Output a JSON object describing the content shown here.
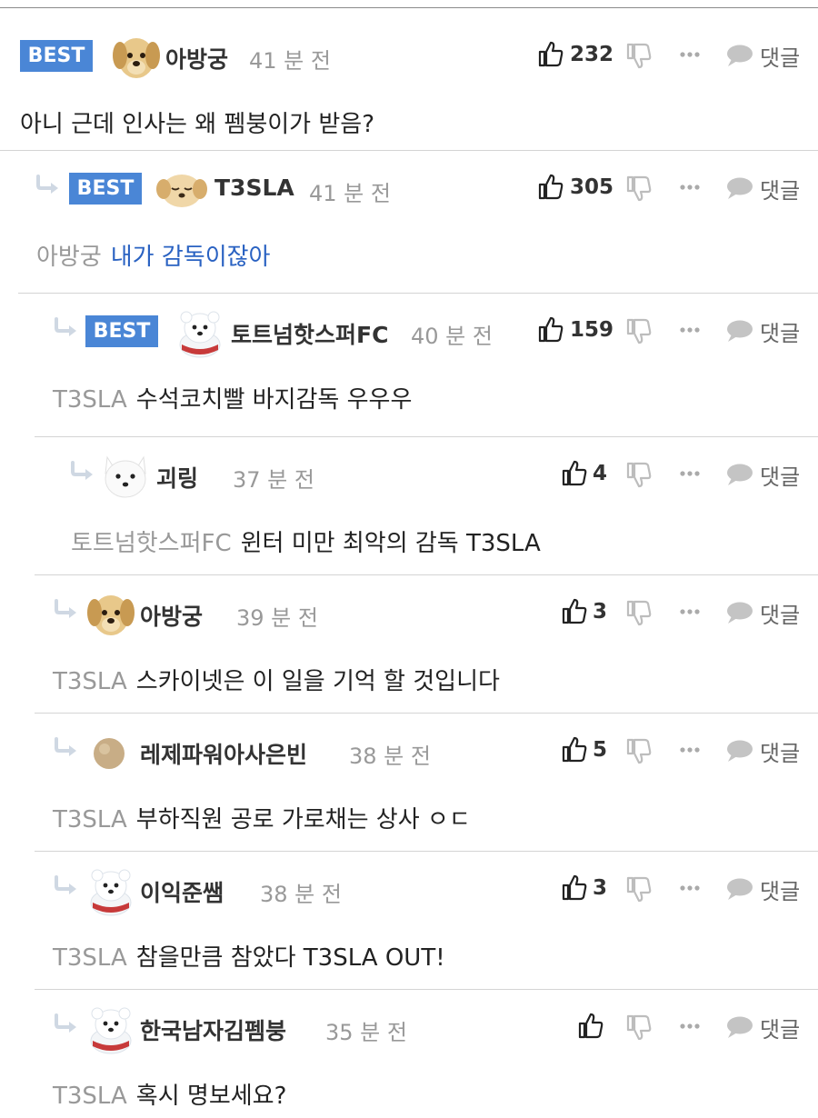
{
  "comments": [
    {
      "best": true,
      "avatar": "puppy",
      "author": "아방궁",
      "time": "41 분 전",
      "likes": "232",
      "mention": "",
      "text": "아니 근데 인사는 왜 펨붕이가 받음?"
    },
    {
      "best": true,
      "avatar": "puppy-sleepy",
      "author": "T3SLA",
      "time": "41 분 전",
      "likes": "305",
      "mention": "아방궁",
      "text": "내가 감독이잖아"
    },
    {
      "best": true,
      "avatar": "white-bear",
      "author": "토트넘핫스퍼FC",
      "time": "40 분 전",
      "likes": "159",
      "mention": "T3SLA",
      "text": "수석코치빨 바지감독 우우우"
    },
    {
      "best": false,
      "avatar": "white-dog",
      "author": "괴링",
      "time": "37 분 전",
      "likes": "4",
      "mention": "토트넘핫스퍼FC",
      "text": "윈터 미만 최악의 감독 T3SLA"
    },
    {
      "best": false,
      "avatar": "puppy",
      "author": "아방궁",
      "time": "39 분 전",
      "likes": "3",
      "mention": "T3SLA",
      "text": "스카이넷은 이 일을 기억 할 것입니다"
    },
    {
      "best": false,
      "avatar": "ball",
      "author": "레제파워아사은빈",
      "time": "38 분 전",
      "likes": "5",
      "mention": "T3SLA",
      "text": "부하직원 공로 가로채는 상사 ㅇㄷ"
    },
    {
      "best": false,
      "avatar": "white-bear",
      "author": "이익준쌤",
      "time": "38 분 전",
      "likes": "3",
      "mention": "T3SLA",
      "text": "참을만큼 참았다 T3SLA OUT!"
    },
    {
      "best": false,
      "avatar": "white-bear",
      "author": "한국남자김펨붕",
      "time": "35 분 전",
      "likes": "",
      "mention": "T3SLA",
      "text": "혹시 명보세요?"
    }
  ],
  "labels": {
    "best_badge": "BEST",
    "reply_button": "댓글"
  },
  "colors": {
    "best_badge": "#4a86d6",
    "reply_link": "#2a62c2"
  },
  "icons": {
    "like": "thumbs-up-icon",
    "dislike": "thumbs-down-icon",
    "more": "more-dots-icon",
    "reply": "speech-bubble-icon",
    "reply_indent": "reply-arrow-icon"
  }
}
